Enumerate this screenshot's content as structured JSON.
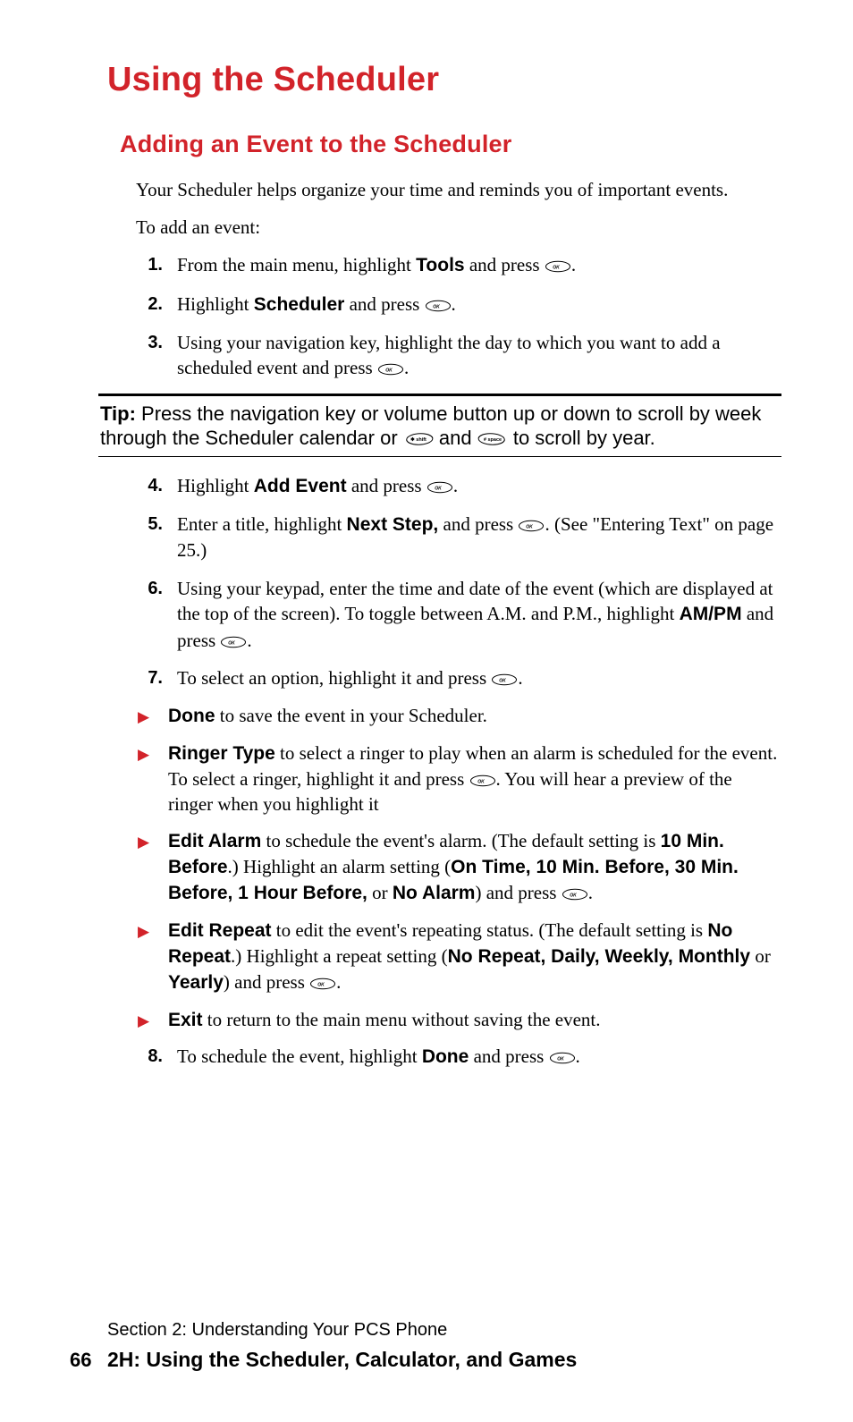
{
  "title": "Using the Scheduler",
  "subtitle": "Adding an Event to the Scheduler",
  "intro1": "Your Scheduler helps organize your time and reminds you of important events.",
  "intro2": "To add an event:",
  "steps_a": [
    {
      "num": "1.",
      "parts": [
        "From the main menu, highlight ",
        "Tools",
        " and press ",
        "OK",
        "."
      ]
    },
    {
      "num": "2.",
      "parts": [
        "Highlight ",
        "Scheduler",
        " and press ",
        "OK",
        "."
      ]
    },
    {
      "num": "3.",
      "parts": [
        "Using your navigation key, highlight the day to which you want to add a scheduled event and press ",
        "OK",
        "."
      ]
    }
  ],
  "tip": {
    "label": "Tip:",
    "parts": [
      " Press the navigation key  or volume button up or down to scroll by week through the Scheduler calendar or ",
      "STAR",
      " and ",
      "POUND",
      " to scroll by year."
    ]
  },
  "steps_b1": [
    {
      "num": "4.",
      "parts": [
        "Highlight ",
        "Add Event",
        " and press ",
        "OK",
        "."
      ]
    },
    {
      "num": "5.",
      "parts": [
        "Enter a title, highlight ",
        "Next Step,",
        " and press ",
        "OK",
        ". (See \"Entering Text\" on page 25.)"
      ]
    },
    {
      "num": "6.",
      "parts": [
        "Using your keypad, enter the time and date of the event (which are displayed at the top of the screen). To toggle between A.M. and P.M., highlight ",
        "AM/PM",
        " and press ",
        "OK",
        "."
      ]
    },
    {
      "num": "7.",
      "parts": [
        "To select an option, highlight it and press ",
        "OK",
        "."
      ]
    }
  ],
  "options": [
    {
      "lead": "Done",
      "tail": " to save the event in your Scheduler."
    },
    {
      "lead": "Ringer Type",
      "tail_parts": [
        " to select a ringer to play when an alarm is scheduled for the event. To select a ringer, highlight it and press ",
        "OK",
        ". You will hear a preview of the ringer when you highlight it"
      ]
    },
    {
      "lead": "Edit Alarm",
      "tail_parts_rich": [
        " to schedule the event's alarm. (The default setting is ",
        {
          "b": "10 Min. Before"
        },
        ".) Highlight an alarm setting (",
        {
          "b": "On Time, 10 Min. Before, 30 Min. Before, 1 Hour Before,"
        },
        " or ",
        {
          "b": "No Alarm"
        },
        ") and press ",
        "OK",
        "."
      ]
    },
    {
      "lead": "Edit Repeat",
      "tail_parts_rich": [
        " to edit the event's repeating status. (The default setting is ",
        {
          "b": "No Repeat"
        },
        ".) Highlight a repeat setting (",
        {
          "b": "No Repeat, Daily, Weekly, Monthly"
        },
        " or ",
        {
          "b": "Yearly"
        },
        ") and press ",
        "OK",
        "."
      ]
    },
    {
      "lead": "Exit",
      "tail": " to return to the main menu without saving the event."
    }
  ],
  "steps_b2": [
    {
      "num": "8.",
      "parts": [
        "To schedule the event, highlight ",
        "Done",
        " and press ",
        "OK",
        "."
      ]
    }
  ],
  "footer": {
    "section": "Section 2: Understanding Your PCS Phone",
    "page": "66",
    "title": "2H: Using the Scheduler, Calculator, and Games"
  }
}
